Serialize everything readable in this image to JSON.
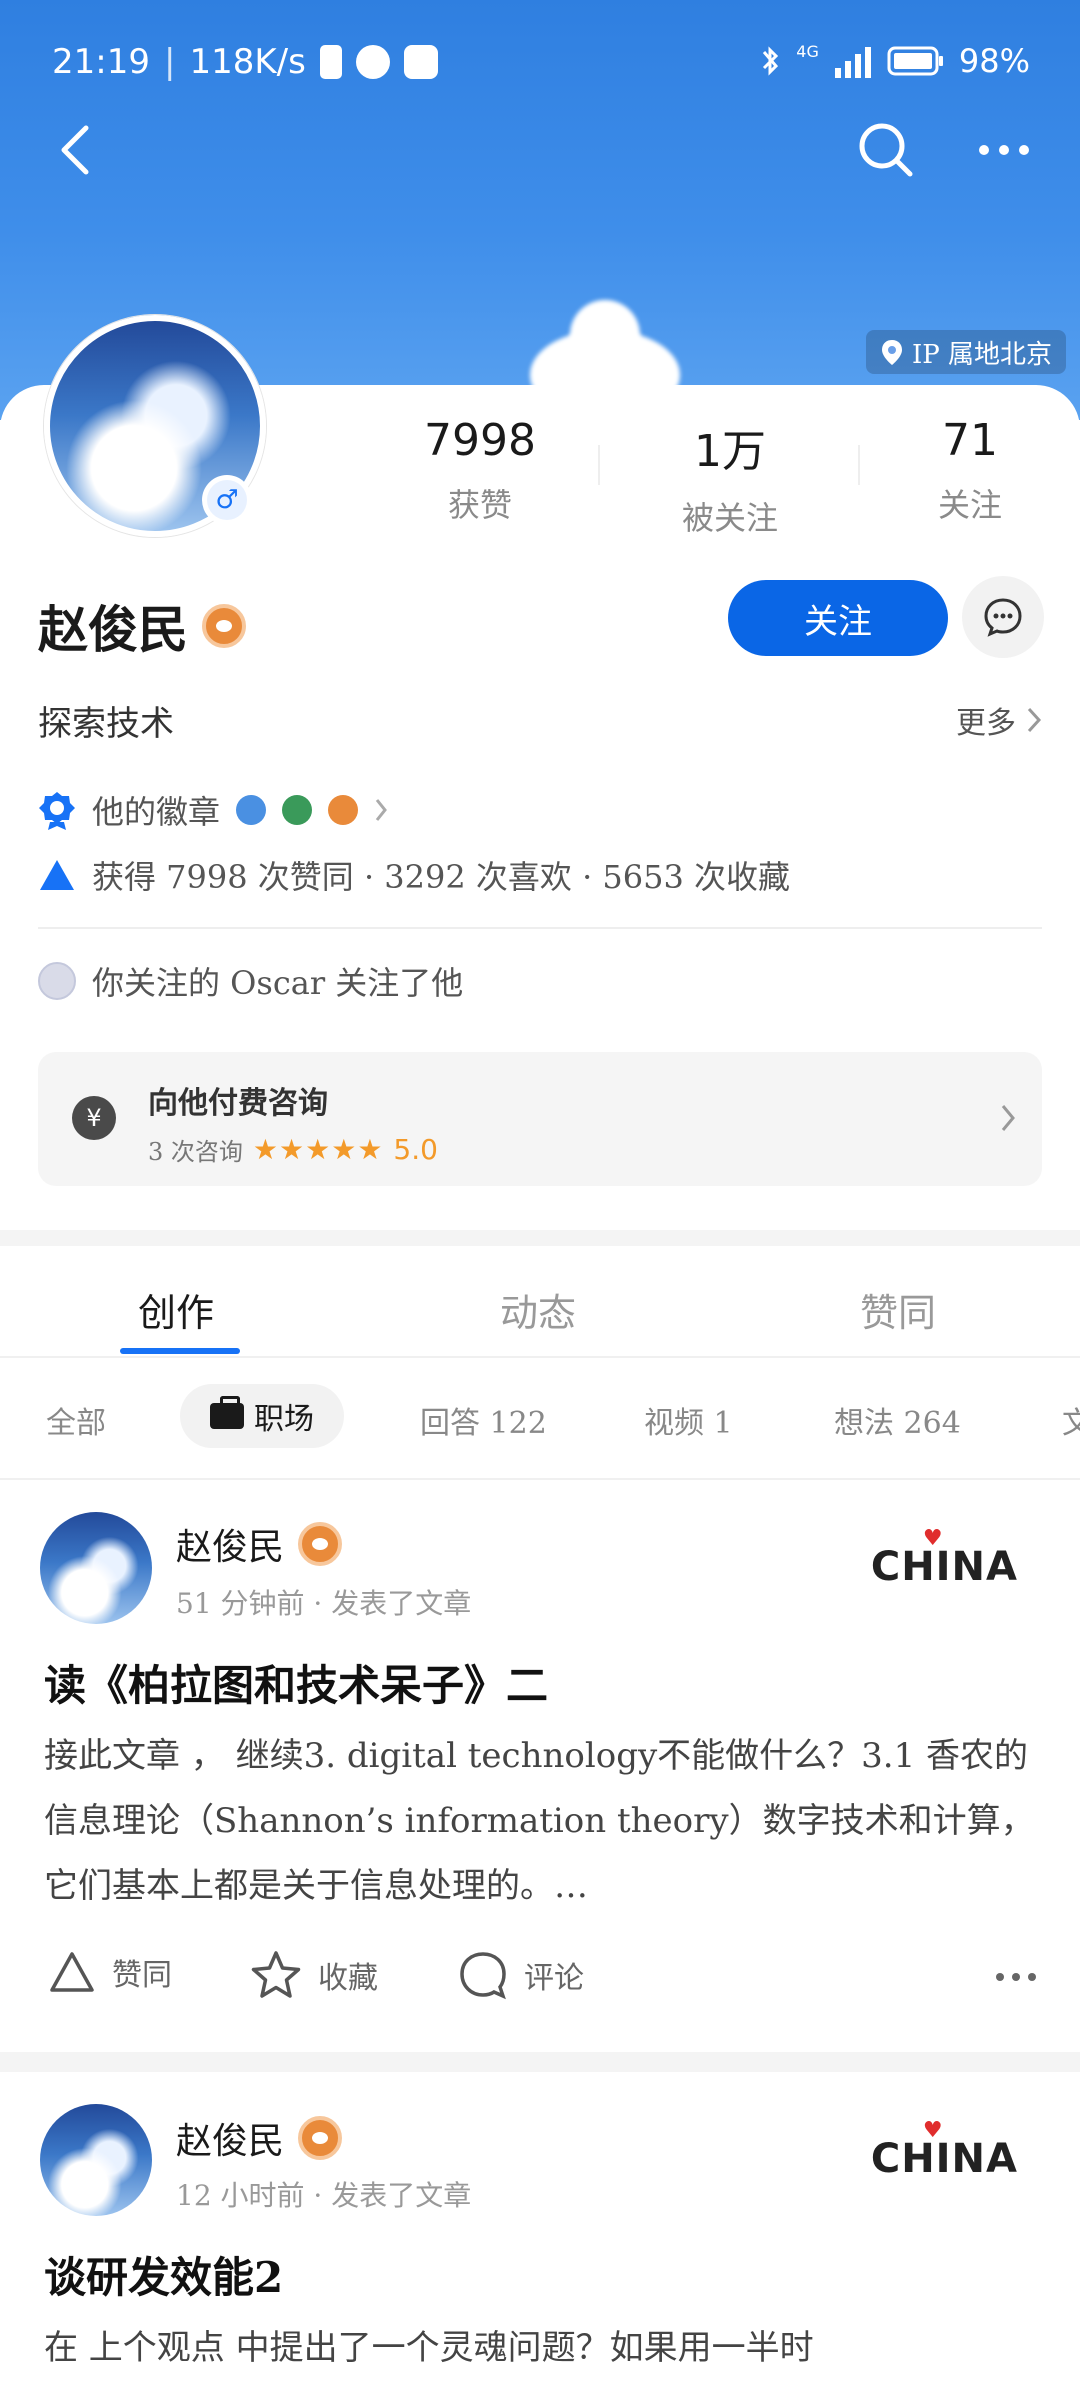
{
  "status": {
    "time": "21:19",
    "speed": "118K/s",
    "network": "4G",
    "battery": "98%"
  },
  "header": {
    "ip_location": "IP 属地北京"
  },
  "profile": {
    "name": "赵俊民",
    "bio": "探索技术",
    "more_label": "更多",
    "follow_label": "关注",
    "stats": [
      {
        "value": "7998",
        "label": "获赞"
      },
      {
        "value": "1万",
        "label": "被关注"
      },
      {
        "value": "71",
        "label": "关注"
      }
    ],
    "badges_label": "他的徽章",
    "achievement": "获得 7998 次赞同 · 3292 次喜欢 · 5653 次收藏",
    "mutual": "你关注的 Oscar 关注了他",
    "consult": {
      "title": "向他付费咨询",
      "count": "3 次咨询",
      "stars": "★★★★★",
      "rating": "5.0"
    }
  },
  "tabs": [
    {
      "label": "创作",
      "active": true
    },
    {
      "label": "动态",
      "active": false
    },
    {
      "label": "赞同",
      "active": false
    }
  ],
  "filters": [
    {
      "label": "全部"
    },
    {
      "label": "职场",
      "active": true
    },
    {
      "label": "回答 122"
    },
    {
      "label": "视频 1"
    },
    {
      "label": "想法 264"
    },
    {
      "label": "文"
    }
  ],
  "posts": [
    {
      "author": "赵俊民",
      "meta": "51 分钟前 · 发表了文章",
      "brand": "CHINA",
      "title": "读《柏拉图和技术呆子》二",
      "body": "接此文章 ， 继续3. digital technology不能做什么？3.1 香农的信息理论（Shannon’s information theory）数字技术和计算，它们基本上都是关于信息处理的。…",
      "actions": [
        "赞同",
        "收藏",
        "评论"
      ]
    },
    {
      "author": "赵俊民",
      "meta": "12 小时前 · 发表了文章",
      "brand": "CHINA",
      "title": "谈研发效能2",
      "body": "在 上个观点 中提出了一个灵魂问题？如果用一半时"
    }
  ]
}
